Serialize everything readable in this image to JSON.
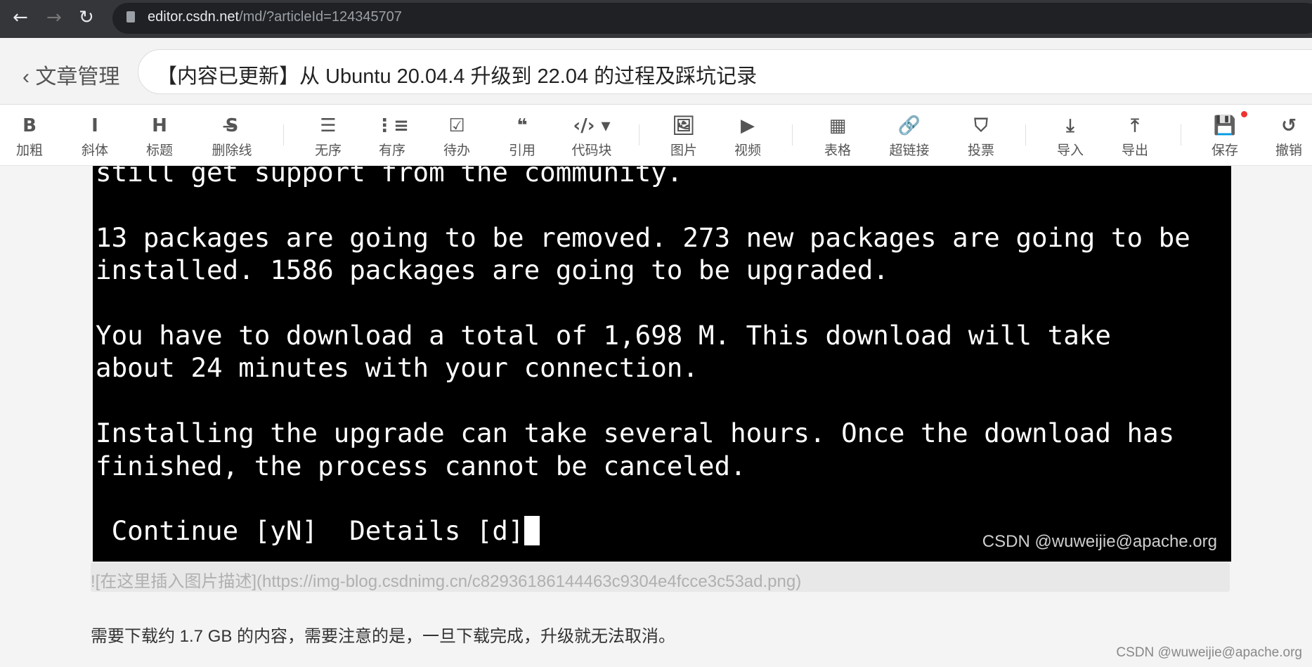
{
  "browser": {
    "back": "←",
    "forward": "→",
    "reload": "↻",
    "url_host": "editor.csdn.net",
    "url_path": "/md/?articleId=124345707"
  },
  "header": {
    "back_label": "文章管理",
    "title": "【内容已更新】从 Ubuntu 20.04.4 升级到 22.04 的过程及踩坑记录"
  },
  "toolbar": [
    {
      "icon": "B",
      "label": "加粗",
      "name": "bold"
    },
    {
      "icon": "I",
      "label": "斜体",
      "name": "italic"
    },
    {
      "icon": "H",
      "label": "标题",
      "name": "heading"
    },
    {
      "icon": "S̶",
      "label": "删除线",
      "name": "strikethrough"
    },
    {
      "icon": "☰",
      "label": "无序",
      "name": "unordered-list"
    },
    {
      "icon": "⋮≡",
      "label": "有序",
      "name": "ordered-list"
    },
    {
      "icon": "☑",
      "label": "待办",
      "name": "todo"
    },
    {
      "icon": "❝",
      "label": "引用",
      "name": "quote"
    },
    {
      "icon": "‹/› ▾",
      "label": "代码块",
      "name": "code-block"
    },
    {
      "icon": "🖼",
      "label": "图片",
      "name": "image"
    },
    {
      "icon": "▶",
      "label": "视频",
      "name": "video"
    },
    {
      "icon": "▦",
      "label": "表格",
      "name": "table"
    },
    {
      "icon": "🔗",
      "label": "超链接",
      "name": "link"
    },
    {
      "icon": "⛉",
      "label": "投票",
      "name": "vote"
    },
    {
      "icon": "⤓",
      "label": "导入",
      "name": "import"
    },
    {
      "icon": "⤒",
      "label": "导出",
      "name": "export"
    },
    {
      "icon": "💾",
      "label": "保存",
      "name": "save"
    },
    {
      "icon": "↺",
      "label": "撤销",
      "name": "undo"
    }
  ],
  "terminal": {
    "lines": [
      "still get support from the community.",
      "",
      "13 packages are going to be removed. 273 new packages are going to be",
      "installed. 1586 packages are going to be upgraded.",
      "",
      "You have to download a total of 1,698 M. This download will take",
      "about 24 minutes with your connection.",
      "",
      "Installing the upgrade can take several hours. Once the download has",
      "finished, the process cannot be canceled.",
      "",
      " Continue [yN]  Details [d]"
    ],
    "watermark": "CSDN @wuweijie@apache.org"
  },
  "editor": {
    "markdown_image": "![在这里插入图片描述](https://img-blog.csdnimg.cn/c82936186144463c9304e4fcce3c53ad.png)",
    "paragraph": "需要下载约 1.7 GB 的内容，需要注意的是，一旦下载完成，升级就无法取消。",
    "watermark": "CSDN @wuweijie@apache.org"
  }
}
